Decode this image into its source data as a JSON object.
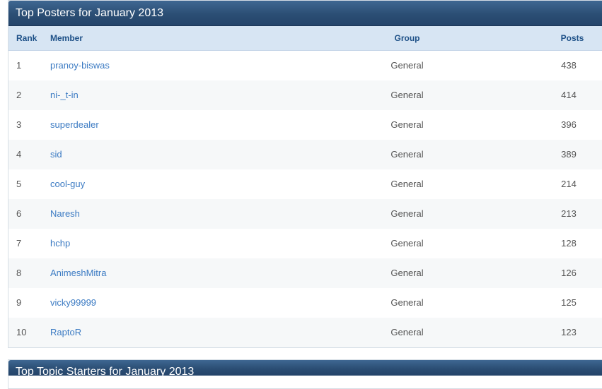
{
  "top_posters": {
    "title": "Top Posters for January 2013",
    "columns": {
      "rank": "Rank",
      "member": "Member",
      "group": "Group",
      "posts": "Posts"
    },
    "rows": [
      {
        "rank": "1",
        "member": "pranoy-biswas",
        "group": "General",
        "posts": "438"
      },
      {
        "rank": "2",
        "member": "ni-_t-in",
        "group": "General",
        "posts": "414"
      },
      {
        "rank": "3",
        "member": "superdealer",
        "group": "General",
        "posts": "396"
      },
      {
        "rank": "4",
        "member": "sid",
        "group": "General",
        "posts": "389"
      },
      {
        "rank": "5",
        "member": "cool-guy",
        "group": "General",
        "posts": "214"
      },
      {
        "rank": "6",
        "member": "Naresh",
        "group": "General",
        "posts": "213"
      },
      {
        "rank": "7",
        "member": "hchp",
        "group": "General",
        "posts": "128"
      },
      {
        "rank": "8",
        "member": "AnimeshMitra",
        "group": "General",
        "posts": "126"
      },
      {
        "rank": "9",
        "member": "vicky99999",
        "group": "General",
        "posts": "125"
      },
      {
        "rank": "10",
        "member": "RaptoR",
        "group": "General",
        "posts": "123"
      }
    ]
  },
  "top_topic_starters": {
    "title": "Top Topic Starters for January 2013"
  },
  "colors": {
    "header_bg": "#2b4e74",
    "column_header_bg": "#d7e5f3",
    "link": "#3c7bc3"
  }
}
